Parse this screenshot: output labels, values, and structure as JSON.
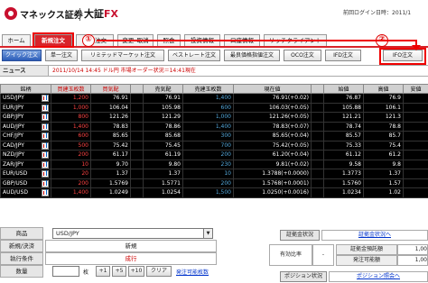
{
  "header": {
    "brand": "マネックス証券",
    "product_prefix": "大証",
    "product_suffix": "FX",
    "last_login": "前回ログイン日時：2011/1"
  },
  "nav": {
    "tabs": [
      {
        "label": "ホーム"
      },
      {
        "label": "新規注文"
      },
      {
        "label": "決済注文"
      },
      {
        "label": "変更･取消"
      },
      {
        "label": "照会"
      },
      {
        "label": "投資情報"
      },
      {
        "label": "口座情報"
      },
      {
        "label": "リッチクライアント"
      }
    ]
  },
  "order_types": [
    {
      "label": "クイック注文"
    },
    {
      "label": "単一注文"
    },
    {
      "label": "リミテッドマーケット注文"
    },
    {
      "label": "ベストレート注文"
    },
    {
      "label": "最良価格指値注文"
    },
    {
      "label": "OCO注文"
    },
    {
      "label": "IFD注文"
    },
    {
      "label": "IFO注文"
    }
  ],
  "news": {
    "label": "ニュース",
    "text": "2011/10/14 14:45 ドル円 市場オーダー状況＝14:41現在"
  },
  "rates": {
    "headers": [
      "銘柄",
      "買建玉枚数",
      "買気配",
      "",
      "売気配",
      "売建玉枚数",
      "現在値",
      "",
      "始値",
      "高値",
      "安値"
    ],
    "rows": [
      [
        "USD/JPY",
        "1,200",
        "76.91",
        "",
        "76.91",
        "1,400",
        "76.91(+0.02)",
        "76.87",
        "76.9"
      ],
      [
        "EUR/JPY",
        "1,000",
        "106.04",
        "",
        "105.98",
        "600",
        "106.03(+0.05)",
        "105.88",
        "106.1"
      ],
      [
        "GBP/JPY",
        "800",
        "121.26",
        "",
        "121.29",
        "1,000",
        "121.26(+0.05)",
        "121.21",
        "121.3"
      ],
      [
        "AUD/JPY",
        "1,400",
        "78.83",
        "",
        "78.86",
        "1,400",
        "78.83(+0.07)",
        "78.74",
        "78.8"
      ],
      [
        "CHF/JPY",
        "600",
        "85.65",
        "",
        "85.68",
        "300",
        "85.65(+0.04)",
        "85.57",
        "85.7"
      ],
      [
        "CAD/JPY",
        "500",
        "75.42",
        "",
        "75.45",
        "700",
        "75.42(+0.05)",
        "75.33",
        "75.4"
      ],
      [
        "NZD/JPY",
        "200",
        "61.17",
        "",
        "61.19",
        "200",
        "61.20(+0.04)",
        "61.12",
        "61.2"
      ],
      [
        "ZAR/JPY",
        "10",
        "9.70",
        "",
        "9.80",
        "230",
        "9.81(+0.02)",
        "9.58",
        "9.8"
      ],
      [
        "EUR/USD",
        "20",
        "1.37",
        "",
        "1.37",
        "10",
        "1.3788(+0.0000)",
        "1.3773",
        "1.37"
      ],
      [
        "GBP/USD",
        "200",
        "1.5769",
        "",
        "1.5771",
        "200",
        "1.5768(+0.0001)",
        "1.5760",
        "1.57"
      ],
      [
        "AUD/USD",
        "1,400",
        "1.0249",
        "",
        "1.0254",
        "1,500",
        "1.0250(+0.0016)",
        "1.0234",
        "1.02"
      ]
    ]
  },
  "order_form": {
    "pair_label": "商品",
    "pair_value": "USD/JPY",
    "type_label": "新規/決済",
    "type_value": "新規",
    "cond_label": "執行条件",
    "cond_value": "成行",
    "qty_label": "数量",
    "qty_unit": "枚",
    "qty_buttons": [
      "+1",
      "+5",
      "+10",
      "クリア"
    ],
    "qty_link": "発注可能枚数"
  },
  "account": {
    "deposit_status_label": "証拠金状況",
    "deposit_status_link": "証拠金状況へ",
    "effective_ratio_label": "有効比率",
    "effective_ratio_value": "-",
    "margin_label": "証拠金預託額",
    "margin_value": "1,00",
    "available_label": "発注可能額",
    "available_value": "1,00",
    "position_label": "ポジション状況",
    "position_link": "ポジション照会へ"
  },
  "annotations": {
    "circle_1": "①",
    "circle_2": "②"
  }
}
